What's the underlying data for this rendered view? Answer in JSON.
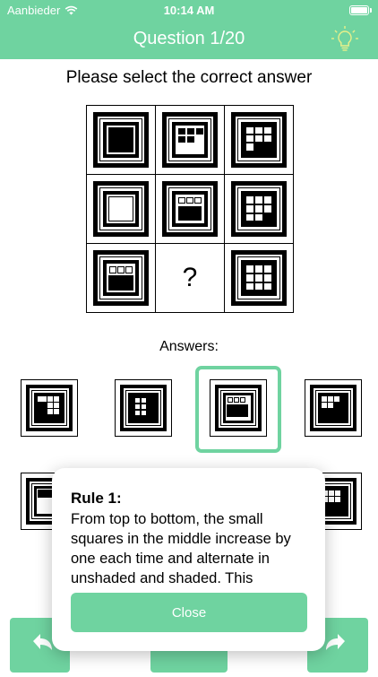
{
  "status_bar": {
    "carrier": "Aanbieder",
    "time": "10:14 AM"
  },
  "header": {
    "title": "Question 1/20",
    "hint_icon": "lightbulb-icon"
  },
  "prompt": "Please select the correct answer",
  "puzzle": {
    "missing_mark": "?"
  },
  "answers": {
    "label": "Answers:"
  },
  "popup": {
    "rule_title": "Rule 1:",
    "rule_text": "From top to bottom, the small squares in the middle increase by one each time and alternate in unshaded and shaded. This",
    "close_label": "Close"
  },
  "nav": {
    "back_icon": "reply-arrow-icon",
    "forward_icon": "forward-arrow-icon"
  },
  "colors": {
    "accent": "#6fd3a0"
  }
}
